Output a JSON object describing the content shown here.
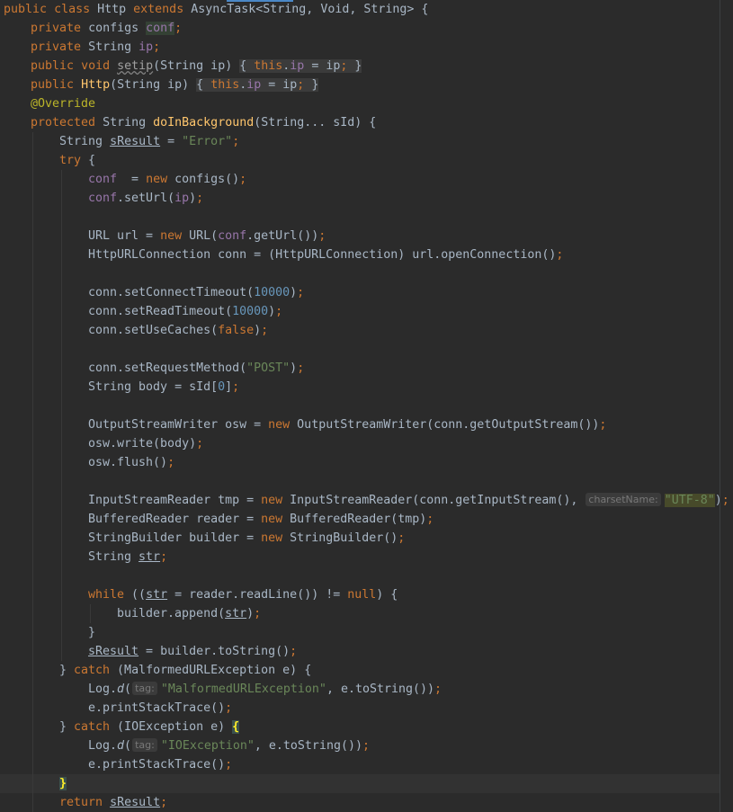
{
  "code": {
    "class_decl": {
      "kw_public": "public",
      "kw_class": "class",
      "class_name": "Http",
      "kw_extends": "extends",
      "parent": "AsyncTask<String, Void, String> {"
    },
    "field_conf": {
      "kw": "private",
      "type": "configs",
      "name": "conf",
      "end": ";"
    },
    "field_ip": {
      "kw": "private",
      "type": "String",
      "name": "ip",
      "end": ";"
    },
    "setip": {
      "kw_public": "public",
      "kw_void": "void",
      "name": "setip",
      "params": "(String ip)",
      "open": "{",
      "kw_this": "this",
      "dot": ".",
      "field": "ip",
      "assign": " = ip",
      "semi": ";",
      "close": "}"
    },
    "ctor": {
      "kw_public": "public",
      "name": "Http",
      "params": "(String ip)",
      "open": "{",
      "kw_this": "this",
      "dot": ".",
      "field": "ip",
      "assign": " = ip",
      "semi": ";",
      "close": "}"
    },
    "annotation": "@Override",
    "do_in_bg": {
      "kw": "protected",
      "type": "String",
      "name": "doInBackground",
      "params": "(String... sId) {"
    },
    "sresult_decl": {
      "type": "String",
      "var": "sResult",
      "assign": " = ",
      "value": "\"Error\"",
      "end": ";"
    },
    "try_line": {
      "kw": "try",
      "rest": " {"
    },
    "conf_new": {
      "field": "conf",
      "assign": "  = ",
      "kw_new": "new",
      "rest": " configs()",
      "end": ";"
    },
    "conf_seturl": {
      "field": "conf",
      "call": ".setUrl(",
      "arg": "ip",
      "end": ")",
      "semi": ";"
    },
    "url_line": {
      "decl": "URL url = ",
      "kw_new": "new",
      "call": " URL(",
      "field": "conf",
      "rest": ".getUrl())",
      "end": ";"
    },
    "conn_line": {
      "text": "HttpURLConnection conn = (HttpURLConnection) url.openConnection()",
      "end": ";"
    },
    "connect_timeout": {
      "call": "conn.setConnectTimeout(",
      "num": "10000",
      "close": ")",
      "end": ";"
    },
    "read_timeout": {
      "call": "conn.setReadTimeout(",
      "num": "10000",
      "close": ")",
      "end": ";"
    },
    "use_caches": {
      "call": "conn.setUseCaches(",
      "kw": "false",
      "close": ")",
      "end": ";"
    },
    "request_method": {
      "call": "conn.setRequestMethod(",
      "str": "\"POST\"",
      "close": ")",
      "end": ";"
    },
    "body_line": {
      "decl": "String body = sId[",
      "num": "0",
      "close": "]",
      "end": ";"
    },
    "osw_line": {
      "decl": "OutputStreamWriter osw = ",
      "kw_new": "new",
      "rest": " OutputStreamWriter(conn.getOutputStream())",
      "end": ";"
    },
    "osw_write": {
      "text": "osw.write(body)",
      "end": ";"
    },
    "osw_flush": {
      "text": "osw.flush()",
      "end": ";"
    },
    "isr_line": {
      "decl": "InputStreamReader tmp = ",
      "kw_new": "new",
      "rest": " InputStreamReader(conn.getInputStream(),",
      "hint": "charsetName:",
      "str": "\"UTF-8\"",
      "close": ")",
      "end": ";"
    },
    "reader_line": {
      "decl": "BufferedReader reader = ",
      "kw_new": "new",
      "rest": " BufferedReader(tmp)",
      "end": ";"
    },
    "builder_line": {
      "decl": "StringBuilder builder = ",
      "kw_new": "new",
      "rest": " StringBuilder()",
      "end": ";"
    },
    "str_decl": {
      "type": "String ",
      "var": "str",
      "end": ";"
    },
    "while_line": {
      "kw": "while",
      "p1": " ((",
      "var": "str",
      "p2": " = reader.readLine()) != ",
      "kw_null": "null",
      "p3": ") {"
    },
    "append_line": {
      "call": "builder.append(",
      "var": "str",
      "close": ")",
      "end": ";"
    },
    "close_brace": "}",
    "sresult_assign": {
      "var": "sResult",
      "rest": " = builder.toString()",
      "end": ";"
    },
    "catch_malformed": {
      "open": "} ",
      "kw": "catch",
      "rest": " (MalformedURLException e) {"
    },
    "log_malformed": {
      "cls": "Log.",
      "method": "d",
      "open": "(",
      "hint": "tag:",
      "str": "\"MalformedURLException\"",
      "rest": ", e.toString())",
      "end": ";"
    },
    "print_trace_1": {
      "text": "e.printStackTrace()",
      "end": ";"
    },
    "catch_io": {
      "open": "} ",
      "kw": "catch",
      "rest": " (IOException e) ",
      "brace": "{"
    },
    "log_io": {
      "cls": "Log.",
      "method": "d",
      "open": "(",
      "hint": "tag:",
      "str": "\"IOException\"",
      "rest": ", e.toString())",
      "end": ";"
    },
    "print_trace_2": {
      "text": "e.printStackTrace()",
      "end": ";"
    },
    "close_try_brace": "}",
    "return_line": {
      "kw": "return",
      "sp": " ",
      "var": "sResult",
      "end": ";"
    }
  },
  "colors": {
    "background": "#2b2b2b",
    "keyword": "#cc7832",
    "field": "#9876aa",
    "string": "#6a8759",
    "number": "#6897bb",
    "annotation": "#bbb529",
    "method_decl": "#ffc66d",
    "text": "#a9b7c6"
  }
}
